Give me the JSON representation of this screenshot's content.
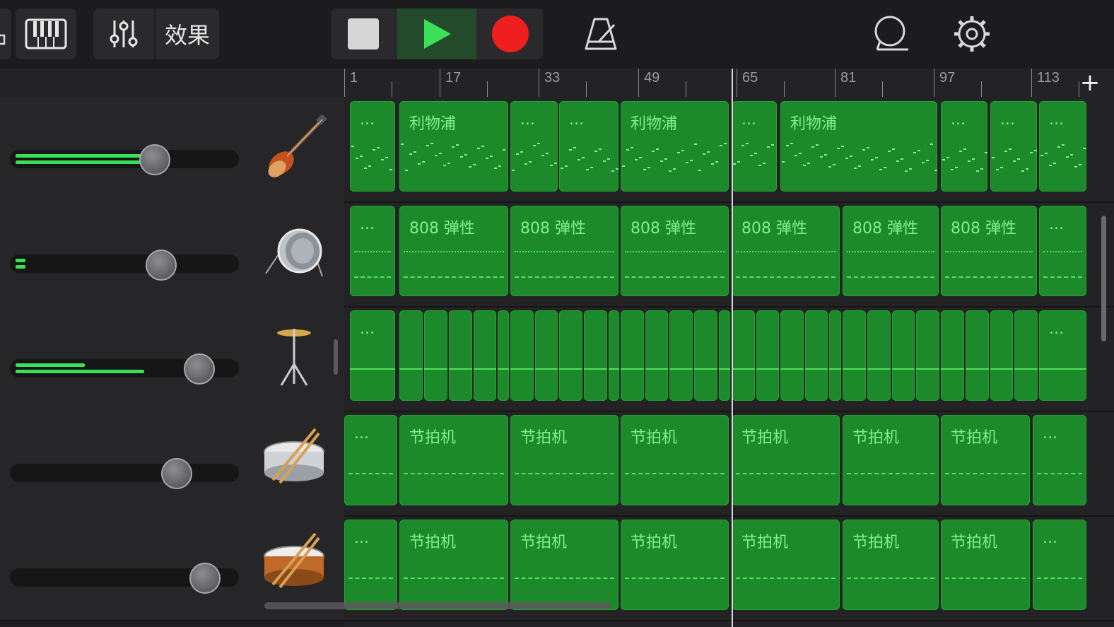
{
  "toolbar": {
    "fx_label": "效果",
    "icons": [
      "tracks-view-icon",
      "keyboard-icon",
      "mixer-icon",
      "stop-icon",
      "play-icon",
      "record-icon",
      "metronome-icon",
      "loop-icon",
      "settings-icon"
    ],
    "add_label": "+"
  },
  "ruler": {
    "bar_numbers": [
      "1",
      "17",
      "33",
      "49",
      "65",
      "81",
      "97",
      "113"
    ]
  },
  "tracks": [
    {
      "instrument": "bass-guitar-icon",
      "volume": 0.64
    },
    {
      "instrument": "drum-kit-icon",
      "volume": 0.67
    },
    {
      "instrument": "cymbal-icon",
      "volume": 0.83
    },
    {
      "instrument": "snare-drum-icon",
      "volume": 0.74
    },
    {
      "instrument": "wood-snare-icon",
      "volume": 0.86
    }
  ],
  "lanes": [
    {
      "regions": [
        {
          "label": "..."
        },
        {
          "label": "利物浦"
        },
        {
          "label": "..."
        },
        {
          "label": "..."
        },
        {
          "label": "利物浦"
        },
        {
          "label": "..."
        },
        {
          "label": "利物浦"
        },
        {
          "label": "..."
        },
        {
          "label": "..."
        },
        {
          "label": "..."
        }
      ]
    },
    {
      "regions": [
        {
          "label": "..."
        },
        {
          "label": "808 弹性"
        },
        {
          "label": "808 弹性"
        },
        {
          "label": "808 弹性"
        },
        {
          "label": "808 弹性"
        },
        {
          "label": "808 弹性"
        },
        {
          "label": "808 弹性"
        },
        {
          "label": "..."
        }
      ]
    },
    {
      "regions": [
        {
          "label": "..."
        },
        {
          "label": "..."
        }
      ]
    },
    {
      "regions": [
        {
          "label": "..."
        },
        {
          "label": "节拍机"
        },
        {
          "label": "节拍机"
        },
        {
          "label": "节拍机"
        },
        {
          "label": "节拍机"
        },
        {
          "label": "节拍机"
        },
        {
          "label": "节拍机"
        },
        {
          "label": "..."
        }
      ]
    },
    {
      "regions": [
        {
          "label": "..."
        },
        {
          "label": "节拍机"
        },
        {
          "label": "节拍机"
        },
        {
          "label": "节拍机"
        },
        {
          "label": "节拍机"
        },
        {
          "label": "节拍机"
        },
        {
          "label": "节拍机"
        },
        {
          "label": "..."
        }
      ]
    }
  ],
  "colors": {
    "region": "#1c8a2a",
    "region_text": "#7ff08a",
    "record": "#f01f1f",
    "play": "#3be05a"
  }
}
